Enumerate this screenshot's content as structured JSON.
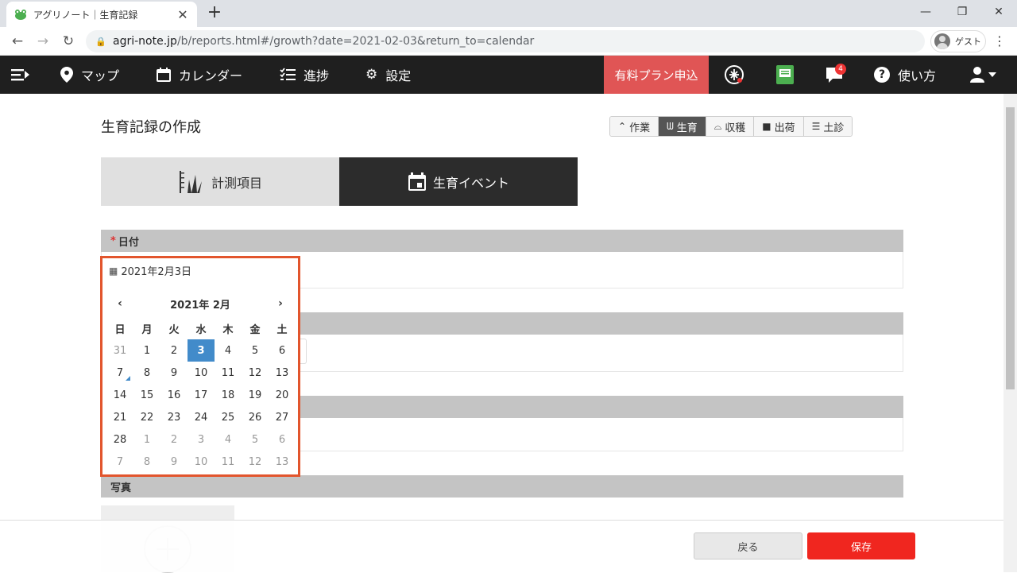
{
  "browser": {
    "tab_title": "アグリノート｜生育記録",
    "new_tab": "+",
    "url_host": "agri-note.jp",
    "url_path": "/b/reports.html#/growth?date=2021-02-03&return_to=calendar",
    "profile_label": "ゲスト"
  },
  "nav": {
    "map": "マップ",
    "calendar": "カレンダー",
    "progress": "進捗",
    "settings": "設定",
    "plan": "有料プラン申込",
    "notifications_count": "4",
    "help": "使い方"
  },
  "page": {
    "title": "生育記録の作成",
    "type_tabs": [
      {
        "label": "作業",
        "icon": "hoe-icon"
      },
      {
        "label": "生育",
        "icon": "plant-icon"
      },
      {
        "label": "収穫",
        "icon": "basket-icon"
      },
      {
        "label": "出荷",
        "icon": "truck-icon"
      },
      {
        "label": "土診",
        "icon": "sliders-icon"
      }
    ],
    "big_tabs": {
      "measure": "計測項目",
      "event": "生育イベント"
    },
    "date_section": {
      "required": "*",
      "label": "日付"
    },
    "photo_section": {
      "label": "写真"
    },
    "back_button": "戻る",
    "save_button": "保存"
  },
  "datepicker": {
    "value": "2021年2月3日",
    "month_label": "2021年 2月",
    "prev": "‹",
    "next": "›",
    "weekdays": [
      "日",
      "月",
      "火",
      "水",
      "木",
      "金",
      "土"
    ],
    "weeks": [
      [
        "31",
        "1",
        "2",
        "3",
        "4",
        "5",
        "6"
      ],
      [
        "7",
        "8",
        "9",
        "10",
        "11",
        "12",
        "13"
      ],
      [
        "14",
        "15",
        "16",
        "17",
        "18",
        "19",
        "20"
      ],
      [
        "21",
        "22",
        "23",
        "24",
        "25",
        "26",
        "27"
      ],
      [
        "28",
        "1",
        "2",
        "3",
        "4",
        "5",
        "6"
      ],
      [
        "7",
        "8",
        "9",
        "10",
        "11",
        "12",
        "13"
      ]
    ],
    "selected": "3"
  },
  "colors": {
    "nav_bg": "#1f1f1f",
    "plan_bg": "#e05555",
    "selected_day": "#428bca",
    "save_button": "#f0261f",
    "highlight_border": "#e2552d"
  }
}
